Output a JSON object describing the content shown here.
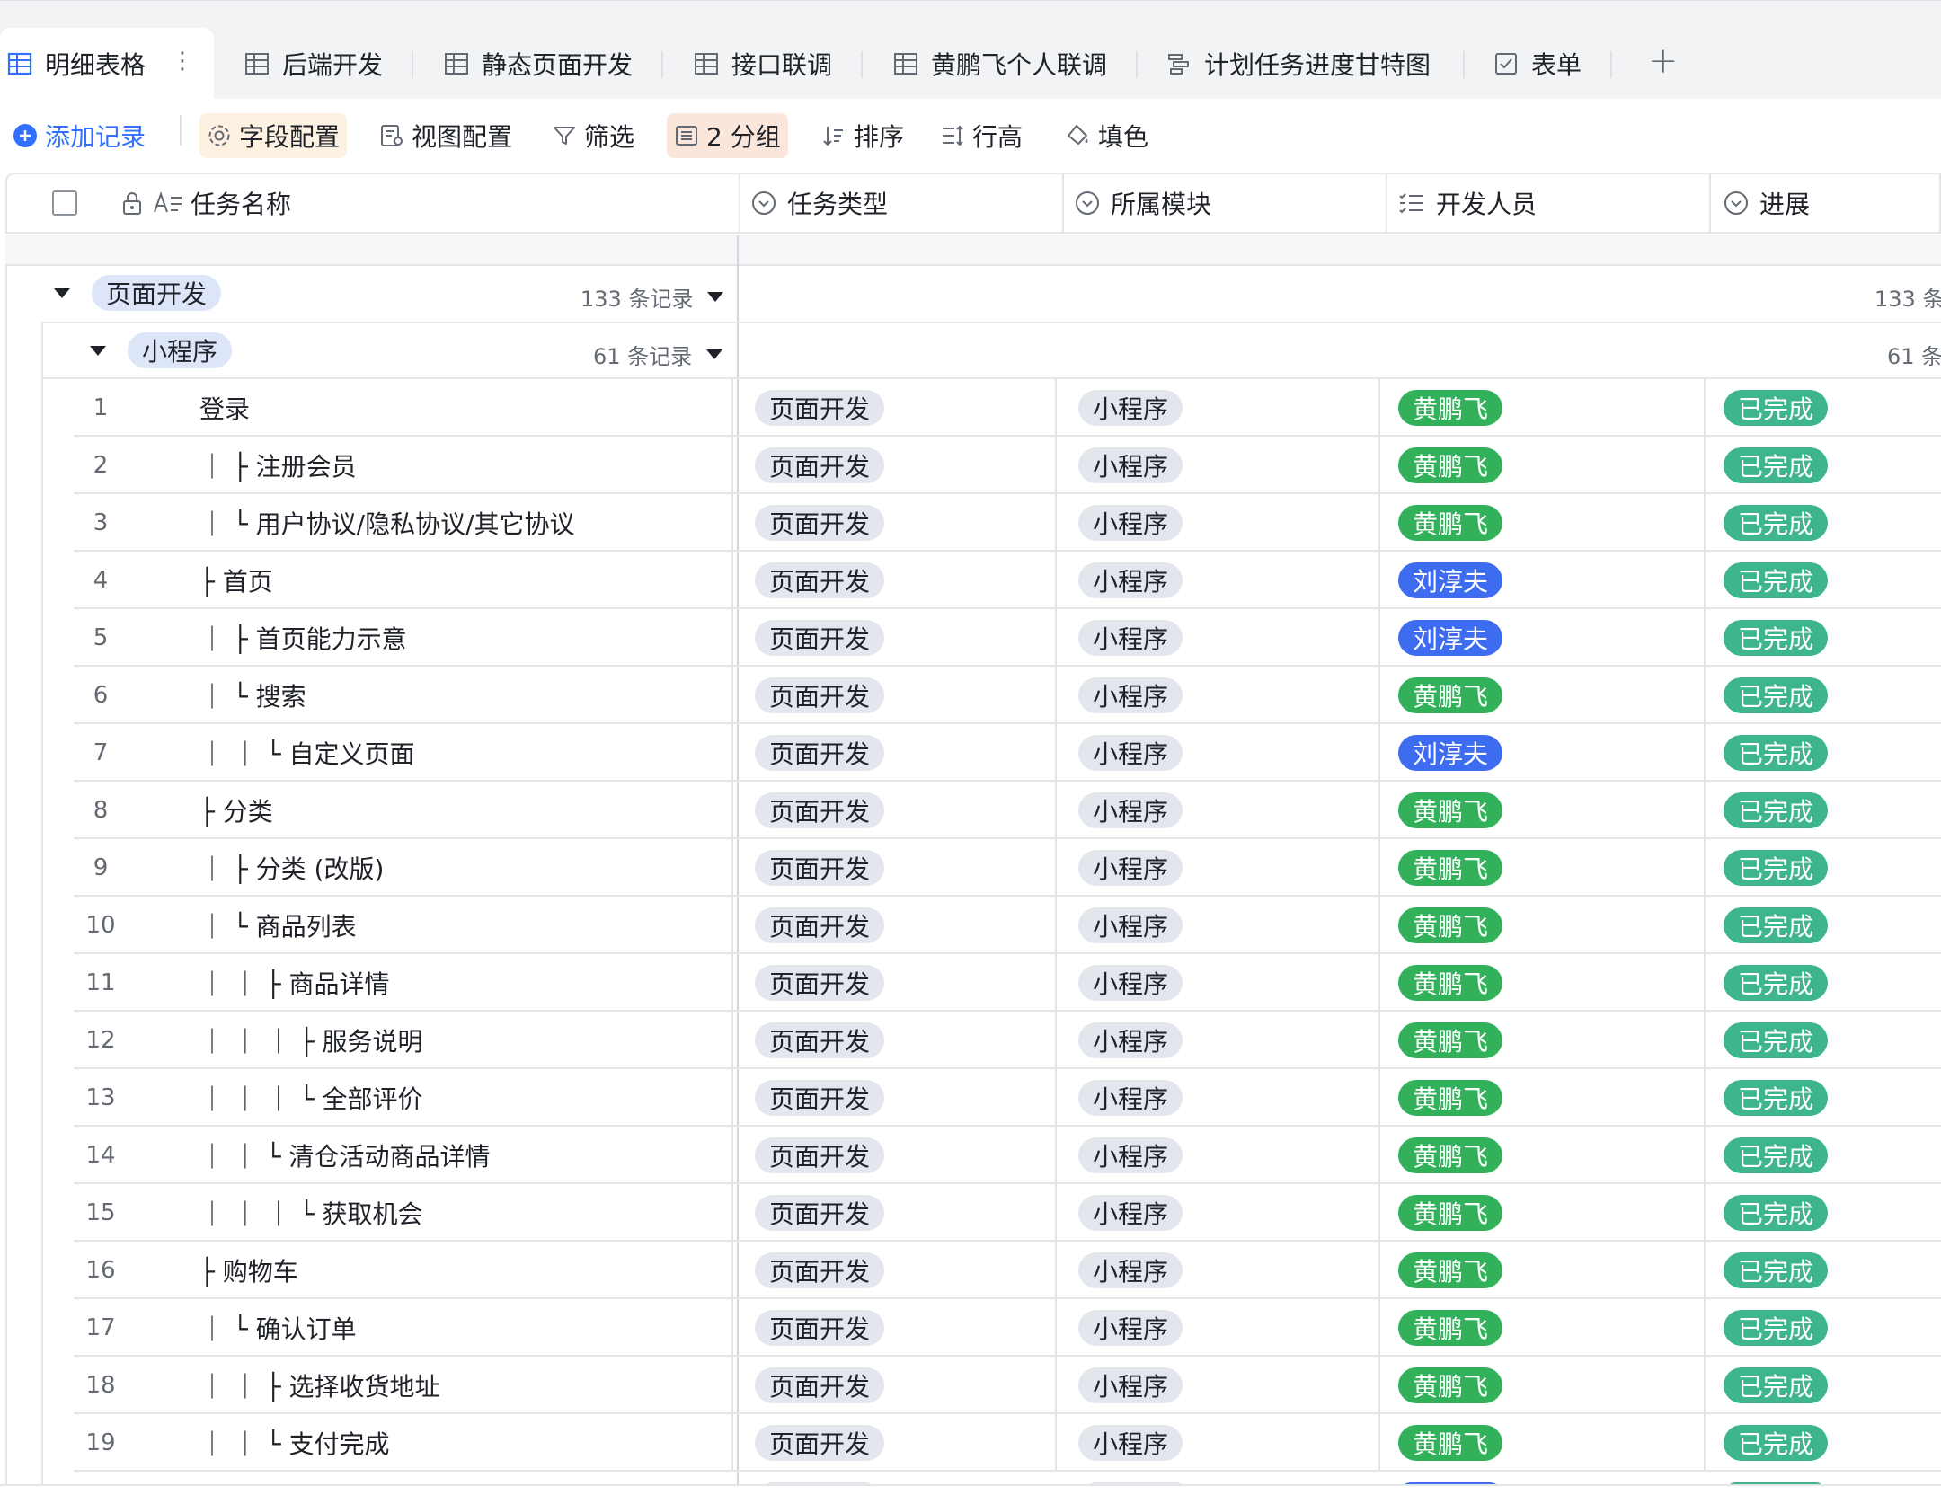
{
  "tabs": {
    "active": {
      "label": "明细表格",
      "icon": "grid-table-icon"
    },
    "items": [
      {
        "label": "后端开发",
        "icon": "grid-table-icon"
      },
      {
        "label": "静态页面开发",
        "icon": "grid-table-icon"
      },
      {
        "label": "接口联调",
        "icon": "grid-table-icon"
      },
      {
        "label": "黄鹏飞个人联调",
        "icon": "grid-table-icon"
      },
      {
        "label": "计划任务进度甘特图",
        "icon": "gantt-icon"
      },
      {
        "label": "表单",
        "icon": "form-icon"
      }
    ],
    "add_symbol": "+",
    "more_symbol": "⋮"
  },
  "toolbar": {
    "add_record": "添加记录",
    "field_config": "字段配置",
    "view_config": "视图配置",
    "filter": "筛选",
    "group": "2 分组",
    "sort": "排序",
    "row_height": "行高",
    "fill_color": "填色"
  },
  "columns": {
    "name": "任务名称",
    "type": "任务类型",
    "module": "所属模块",
    "developer": "开发人员",
    "progress": "进展"
  },
  "groups": {
    "level1": {
      "label": "页面开发",
      "count": "133 条记录",
      "count_right": "133 条"
    },
    "level2": {
      "label": "小程序",
      "count": "61 条记录",
      "count_right": "61 条"
    }
  },
  "colors": {
    "accent": "#3370ff",
    "dev_green": "#33b05a",
    "dev_blue": "#3e6cf0",
    "status_done": "#3fb58d",
    "tag_gray": "#e3e6ec"
  },
  "rows": [
    {
      "num": "1",
      "name": "登录",
      "type": "页面开发",
      "module": "小程序",
      "dev": "黄鹏飞",
      "dev_color": "green",
      "status": "已完成"
    },
    {
      "num": "2",
      "name": "｜ ├ 注册会员",
      "type": "页面开发",
      "module": "小程序",
      "dev": "黄鹏飞",
      "dev_color": "green",
      "status": "已完成"
    },
    {
      "num": "3",
      "name": "｜ └ 用户协议/隐私协议/其它协议",
      "type": "页面开发",
      "module": "小程序",
      "dev": "黄鹏飞",
      "dev_color": "green",
      "status": "已完成"
    },
    {
      "num": "4",
      "name": "├ 首页",
      "type": "页面开发",
      "module": "小程序",
      "dev": "刘淳夫",
      "dev_color": "blue",
      "status": "已完成"
    },
    {
      "num": "5",
      "name": "｜ ├ 首页能力示意",
      "type": "页面开发",
      "module": "小程序",
      "dev": "刘淳夫",
      "dev_color": "blue",
      "status": "已完成"
    },
    {
      "num": "6",
      "name": "｜ └ 搜索",
      "type": "页面开发",
      "module": "小程序",
      "dev": "黄鹏飞",
      "dev_color": "green",
      "status": "已完成"
    },
    {
      "num": "7",
      "name": "｜ ｜ └ 自定义页面",
      "type": "页面开发",
      "module": "小程序",
      "dev": "刘淳夫",
      "dev_color": "blue",
      "status": "已完成"
    },
    {
      "num": "8",
      "name": "├ 分类",
      "type": "页面开发",
      "module": "小程序",
      "dev": "黄鹏飞",
      "dev_color": "green",
      "status": "已完成"
    },
    {
      "num": "9",
      "name": "｜ ├ 分类 (改版)",
      "type": "页面开发",
      "module": "小程序",
      "dev": "黄鹏飞",
      "dev_color": "green",
      "status": "已完成"
    },
    {
      "num": "10",
      "name": "｜ └ 商品列表",
      "type": "页面开发",
      "module": "小程序",
      "dev": "黄鹏飞",
      "dev_color": "green",
      "status": "已完成"
    },
    {
      "num": "11",
      "name": "｜ ｜ ├ 商品详情",
      "type": "页面开发",
      "module": "小程序",
      "dev": "黄鹏飞",
      "dev_color": "green",
      "status": "已完成"
    },
    {
      "num": "12",
      "name": "｜ ｜ ｜ ├ 服务说明",
      "type": "页面开发",
      "module": "小程序",
      "dev": "黄鹏飞",
      "dev_color": "green",
      "status": "已完成"
    },
    {
      "num": "13",
      "name": "｜ ｜ ｜ └ 全部评价",
      "type": "页面开发",
      "module": "小程序",
      "dev": "黄鹏飞",
      "dev_color": "green",
      "status": "已完成"
    },
    {
      "num": "14",
      "name": "｜ ｜ └ 清仓活动商品详情",
      "type": "页面开发",
      "module": "小程序",
      "dev": "黄鹏飞",
      "dev_color": "green",
      "status": "已完成"
    },
    {
      "num": "15",
      "name": "｜ ｜ ｜ └ 获取机会",
      "type": "页面开发",
      "module": "小程序",
      "dev": "黄鹏飞",
      "dev_color": "green",
      "status": "已完成"
    },
    {
      "num": "16",
      "name": "├ 购物车",
      "type": "页面开发",
      "module": "小程序",
      "dev": "黄鹏飞",
      "dev_color": "green",
      "status": "已完成"
    },
    {
      "num": "17",
      "name": "｜ └ 确认订单",
      "type": "页面开发",
      "module": "小程序",
      "dev": "黄鹏飞",
      "dev_color": "green",
      "status": "已完成"
    },
    {
      "num": "18",
      "name": "｜ ｜ ├ 选择收货地址",
      "type": "页面开发",
      "module": "小程序",
      "dev": "黄鹏飞",
      "dev_color": "green",
      "status": "已完成"
    },
    {
      "num": "19",
      "name": "｜ ｜ └ 支付完成",
      "type": "页面开发",
      "module": "小程序",
      "dev": "黄鹏飞",
      "dev_color": "green",
      "status": "已完成"
    }
  ]
}
